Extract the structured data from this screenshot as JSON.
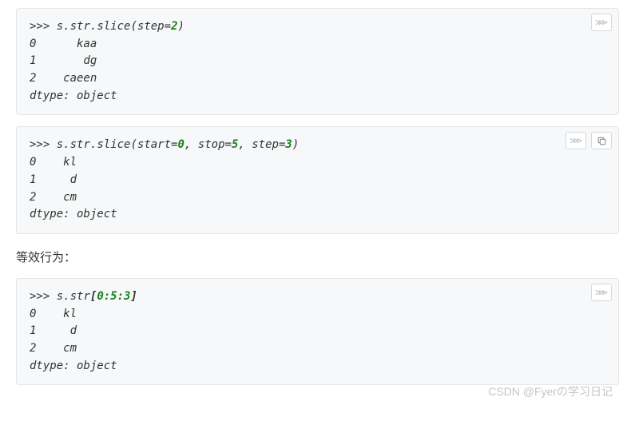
{
  "block1": {
    "line1_prompt": ">>> ",
    "line1_code1": "s",
    "line1_dot1": ".",
    "line1_code2": "str",
    "line1_dot2": ".",
    "line1_code3": "slice(step",
    "line1_eq": "=",
    "line1_num": "2",
    "line1_close": ")",
    "out1": "0      kaa",
    "out2": "1       dg",
    "out3": "2    caeen",
    "out4": "dtype: object"
  },
  "block2": {
    "line1_prompt": ">>> ",
    "line1_a": "s",
    "line1_d1": ".",
    "line1_b": "str",
    "line1_d2": ".",
    "line1_c": "slice(start",
    "line1_e1": "=",
    "line1_n1": "0",
    "line1_s1": ", stop",
    "line1_e2": "=",
    "line1_n2": "5",
    "line1_s2": ", step",
    "line1_e3": "=",
    "line1_n3": "3",
    "line1_close": ")",
    "out1": "0    kl",
    "out2": "1     d",
    "out3": "2    cm",
    "out4": "dtype: object"
  },
  "label": "等效行为：",
  "block3": {
    "line1_prompt": ">>> ",
    "line1_a": "s",
    "line1_d1": ".",
    "line1_b": "str",
    "line1_open": "[",
    "line1_slice": "0:5:3",
    "line1_close": "]",
    "out1": "0    kl",
    "out2": "1     d",
    "out3": "2    cm",
    "out4": "dtype: object"
  },
  "watermark": "CSDN @Fyerの学习日记"
}
